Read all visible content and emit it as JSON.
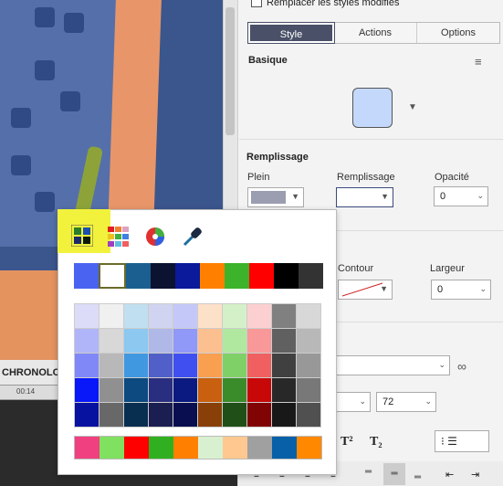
{
  "canvas": {
    "title": "CHRONOLO",
    "ruler_mark": "00:14"
  },
  "panel": {
    "checkbox_label": "Remplacer les styles modifiés",
    "tabs": [
      {
        "label": "Style"
      },
      {
        "label": "Actions"
      },
      {
        "label": "Options"
      }
    ],
    "basique": "Basique",
    "remplissage_title": "Remplissage",
    "plein": "Plein",
    "remplissage": "Remplissage",
    "opacite": "Opacité",
    "opacite_value": "0",
    "contour": "Contour",
    "largeur": "Largeur",
    "largeur_value": "0",
    "font_size": "72",
    "superscript": "T²",
    "subscript": "T₂",
    "fill_color": "#c3d8fb"
  },
  "picker": {
    "recent": [
      "#4a63f0",
      "#ffffff",
      "#1a5f8f",
      "#0c1330",
      "#0a1a9a",
      "#ff8000",
      "#3cb32a",
      "#ff0000",
      "#000000",
      "#333333"
    ],
    "grid": [
      "#dcdcf8",
      "#f0f0f0",
      "#c0dff0",
      "#d0d4f0",
      "#c4c8f8",
      "#fde0c8",
      "#d4f0c8",
      "#fcd0d0",
      "#808080",
      "#d8d8d8",
      "#b0b4f8",
      "#d8d8d8",
      "#8cc8f0",
      "#b0b8e8",
      "#9098f8",
      "#fcc090",
      "#b0e8a0",
      "#f89898",
      "#606060",
      "#b8b8b8",
      "#8088f8",
      "#b8b8b8",
      "#4098e0",
      "#5060c8",
      "#4050f0",
      "#f8a050",
      "#80d068",
      "#f06060",
      "#404040",
      "#989898",
      "#0818f8",
      "#909090",
      "#0c4a80",
      "#2a2e80",
      "#0a1a80",
      "#c86010",
      "#3a8c2a",
      "#c80808",
      "#282828",
      "#787878",
      "#0812a0",
      "#686868",
      "#082e50",
      "#1a1e50",
      "#080e50",
      "#884008",
      "#205018",
      "#800404",
      "#181818",
      "#505050"
    ],
    "bottom": [
      "#f04080",
      "#80e060",
      "#ff0000",
      "#30b020",
      "#ff8000",
      "#d8f0d0",
      "#ffc890",
      "#a0a0a0",
      "#0860a8",
      "#ff8800"
    ]
  }
}
